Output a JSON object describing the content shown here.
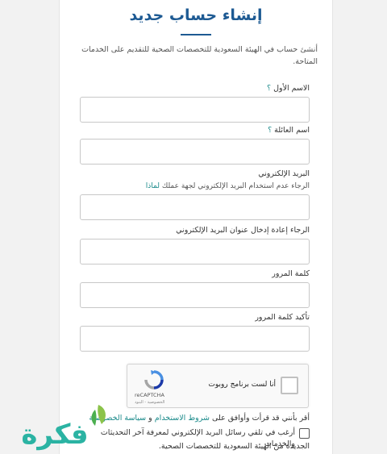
{
  "page": {
    "title": "إنشاء حساب جديد",
    "intro": "أنشئ حساب في الهيئة السعودية للتخصصات الصحية للتقديم على الخدمات المتاحة."
  },
  "form": {
    "first_name": {
      "label": "الاسم الأول",
      "help": "؟",
      "value": ""
    },
    "family_name": {
      "label": "اسم العائلة",
      "help": "؟",
      "value": ""
    },
    "email": {
      "label": "البريد الإلكتروني",
      "note": "الرجاء عدم استخدام البريد الإلكتروني لجهة عملك",
      "note_link": "لماذا",
      "value": ""
    },
    "email_confirm": {
      "label": "الرجاء إعادة إدخال عنوان البريد الإلكتروني",
      "value": ""
    },
    "password": {
      "label": "كلمة المرور",
      "value": ""
    },
    "password_confirm": {
      "label": "تأكيد كلمة المرور",
      "value": ""
    }
  },
  "recaptcha": {
    "label": "أنا لست برنامج روبوت",
    "brand": "reCAPTCHA",
    "privacy": "الخصوصية",
    "separator": " - ",
    "terms": "البنود"
  },
  "terms": {
    "prefix": "أقر بأنني قد قرأت وأوافق على",
    "terms_link": "شروط الاستخدام",
    "conjunction": "و",
    "privacy_link": "سياسة الخصوصية"
  },
  "optin": {
    "line1": "أرغب في تلقي رسائل البريد الإلكتروني لمعرفة آخر التحديثات والخدمات",
    "line2": "الجديدة من الهيئة السعودية للتخصصات الصحية."
  },
  "watermark": {
    "text": "فكرة",
    "colors": {
      "text": "#2bb3a3",
      "leaf": "#8bc34a"
    }
  },
  "colors": {
    "title": "#1d5a93",
    "link": "#1a8a8a",
    "background": "#f2f2f2"
  }
}
